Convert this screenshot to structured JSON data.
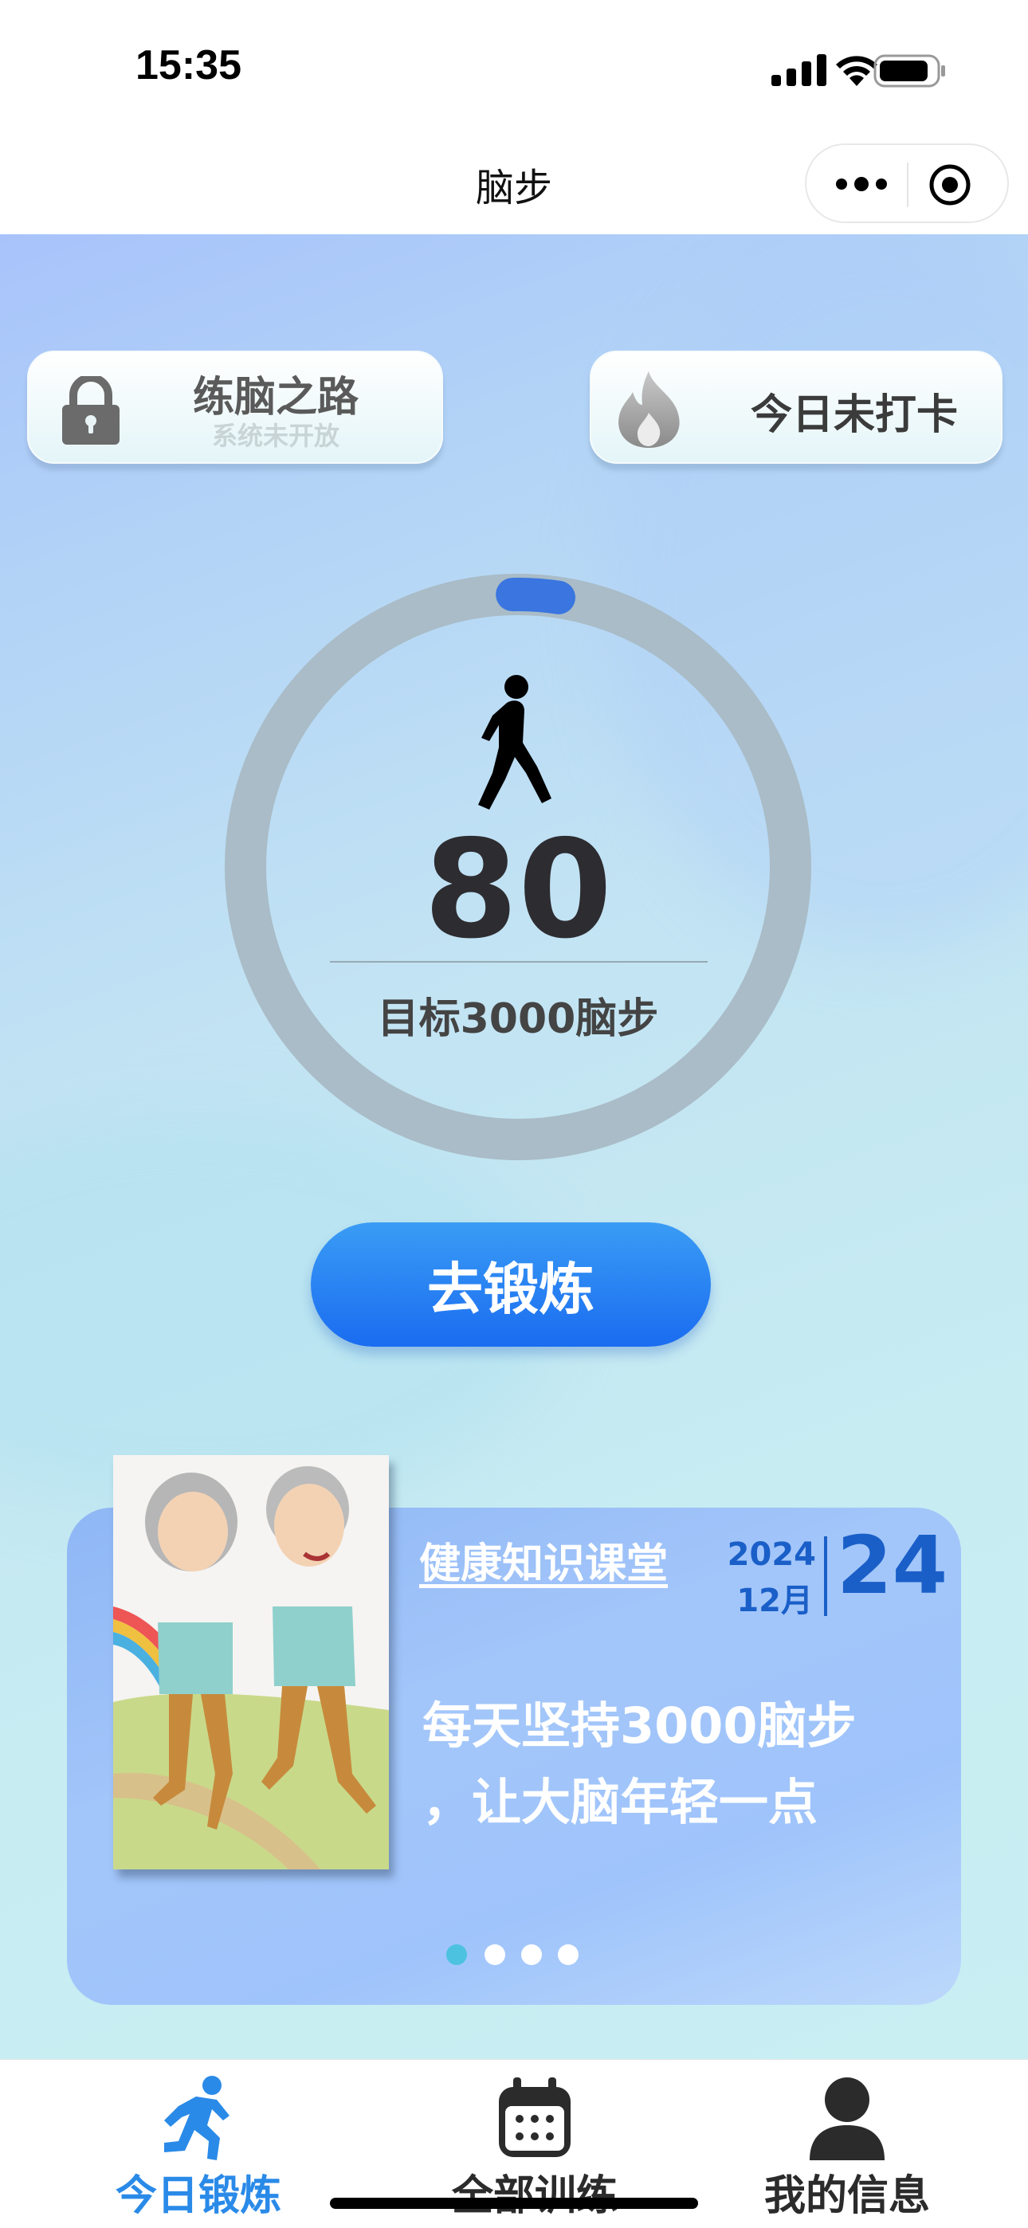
{
  "status_bar": {
    "time": "15:35",
    "icons": [
      "signal-icon",
      "wifi-icon",
      "battery-icon"
    ]
  },
  "nav": {
    "title": "脑步",
    "capsule_icons": [
      "more-icon",
      "close-icon"
    ]
  },
  "cards": {
    "brain_path": {
      "title": "练脑之路",
      "subtitle": "系统未开放",
      "icon": "lock-icon"
    },
    "checkin": {
      "title": "今日未打卡",
      "icon": "fire-icon"
    }
  },
  "progress": {
    "steps": "80",
    "goal_text": "目标3000脑步",
    "goal": 3000,
    "current": 80,
    "fraction": 0.027,
    "icon": "walker-icon"
  },
  "actions": {
    "go_label": "去锻炼"
  },
  "knowledge": {
    "title": "健康知识课堂",
    "year": "2024",
    "month": "12月",
    "day": "24",
    "line1": "每天坚持3000脑步",
    "line2": "，让大脑年轻一点",
    "pager": {
      "count": 4,
      "active": 0
    }
  },
  "tabs": [
    {
      "label": "今日锻炼",
      "icon": "running-icon",
      "active": true
    },
    {
      "label": "全部训练",
      "icon": "calendar-icon",
      "active": false
    },
    {
      "label": "我的信息",
      "icon": "user-icon",
      "active": false
    }
  ],
  "colors": {
    "accent": "#2a8ae8",
    "button": "#1a6cf0",
    "ring_track": "#a9bcc7",
    "ring_progress": "#3a75e0",
    "date": "#1a5fc8"
  }
}
